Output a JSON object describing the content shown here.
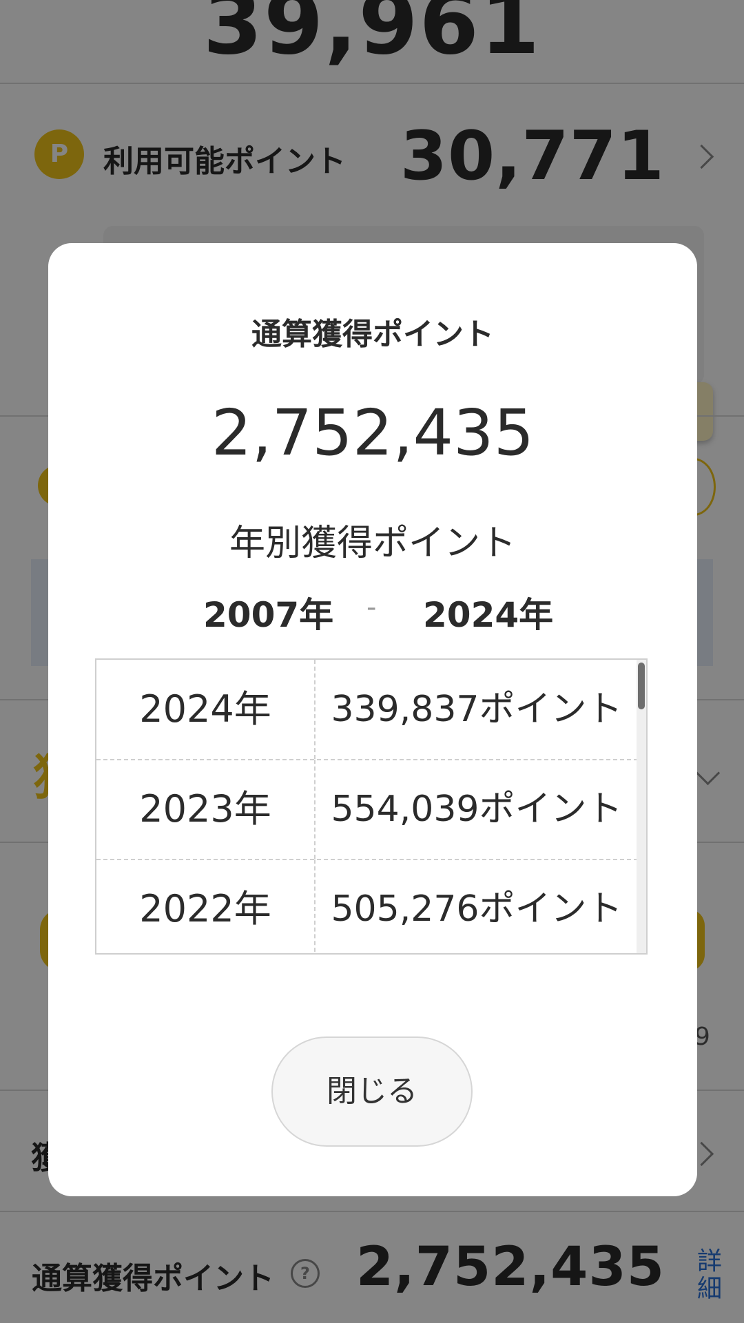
{
  "background": {
    "top_number": "39,961",
    "available": {
      "label": "利用可能ポイント",
      "value": "30,771",
      "icon": "P"
    },
    "partial_glyph_row1": "獲",
    "partial_number": "9",
    "partial_glyph_row2": "獲",
    "cumulative": {
      "label": "通算獲得ポイント",
      "value": "2,752,435",
      "help": "?",
      "detail_link": "詳細"
    }
  },
  "modal": {
    "title": "通算獲得ポイント",
    "total": "2,752,435",
    "subtitle": "年別獲得ポイント",
    "range": {
      "from": "2007年",
      "separator": "-",
      "to": "2024年"
    },
    "rows": [
      {
        "year": "2024年",
        "points": "339,837ポイント"
      },
      {
        "year": "2023年",
        "points": "554,039ポイント"
      },
      {
        "year": "2022年",
        "points": "505,276ポイント"
      }
    ],
    "close_label": "閉じる"
  },
  "colors": {
    "accent_yellow": "#f0c419",
    "link_blue": "#2a6fd6",
    "overlay": "rgba(0,0,0,0.48)"
  }
}
